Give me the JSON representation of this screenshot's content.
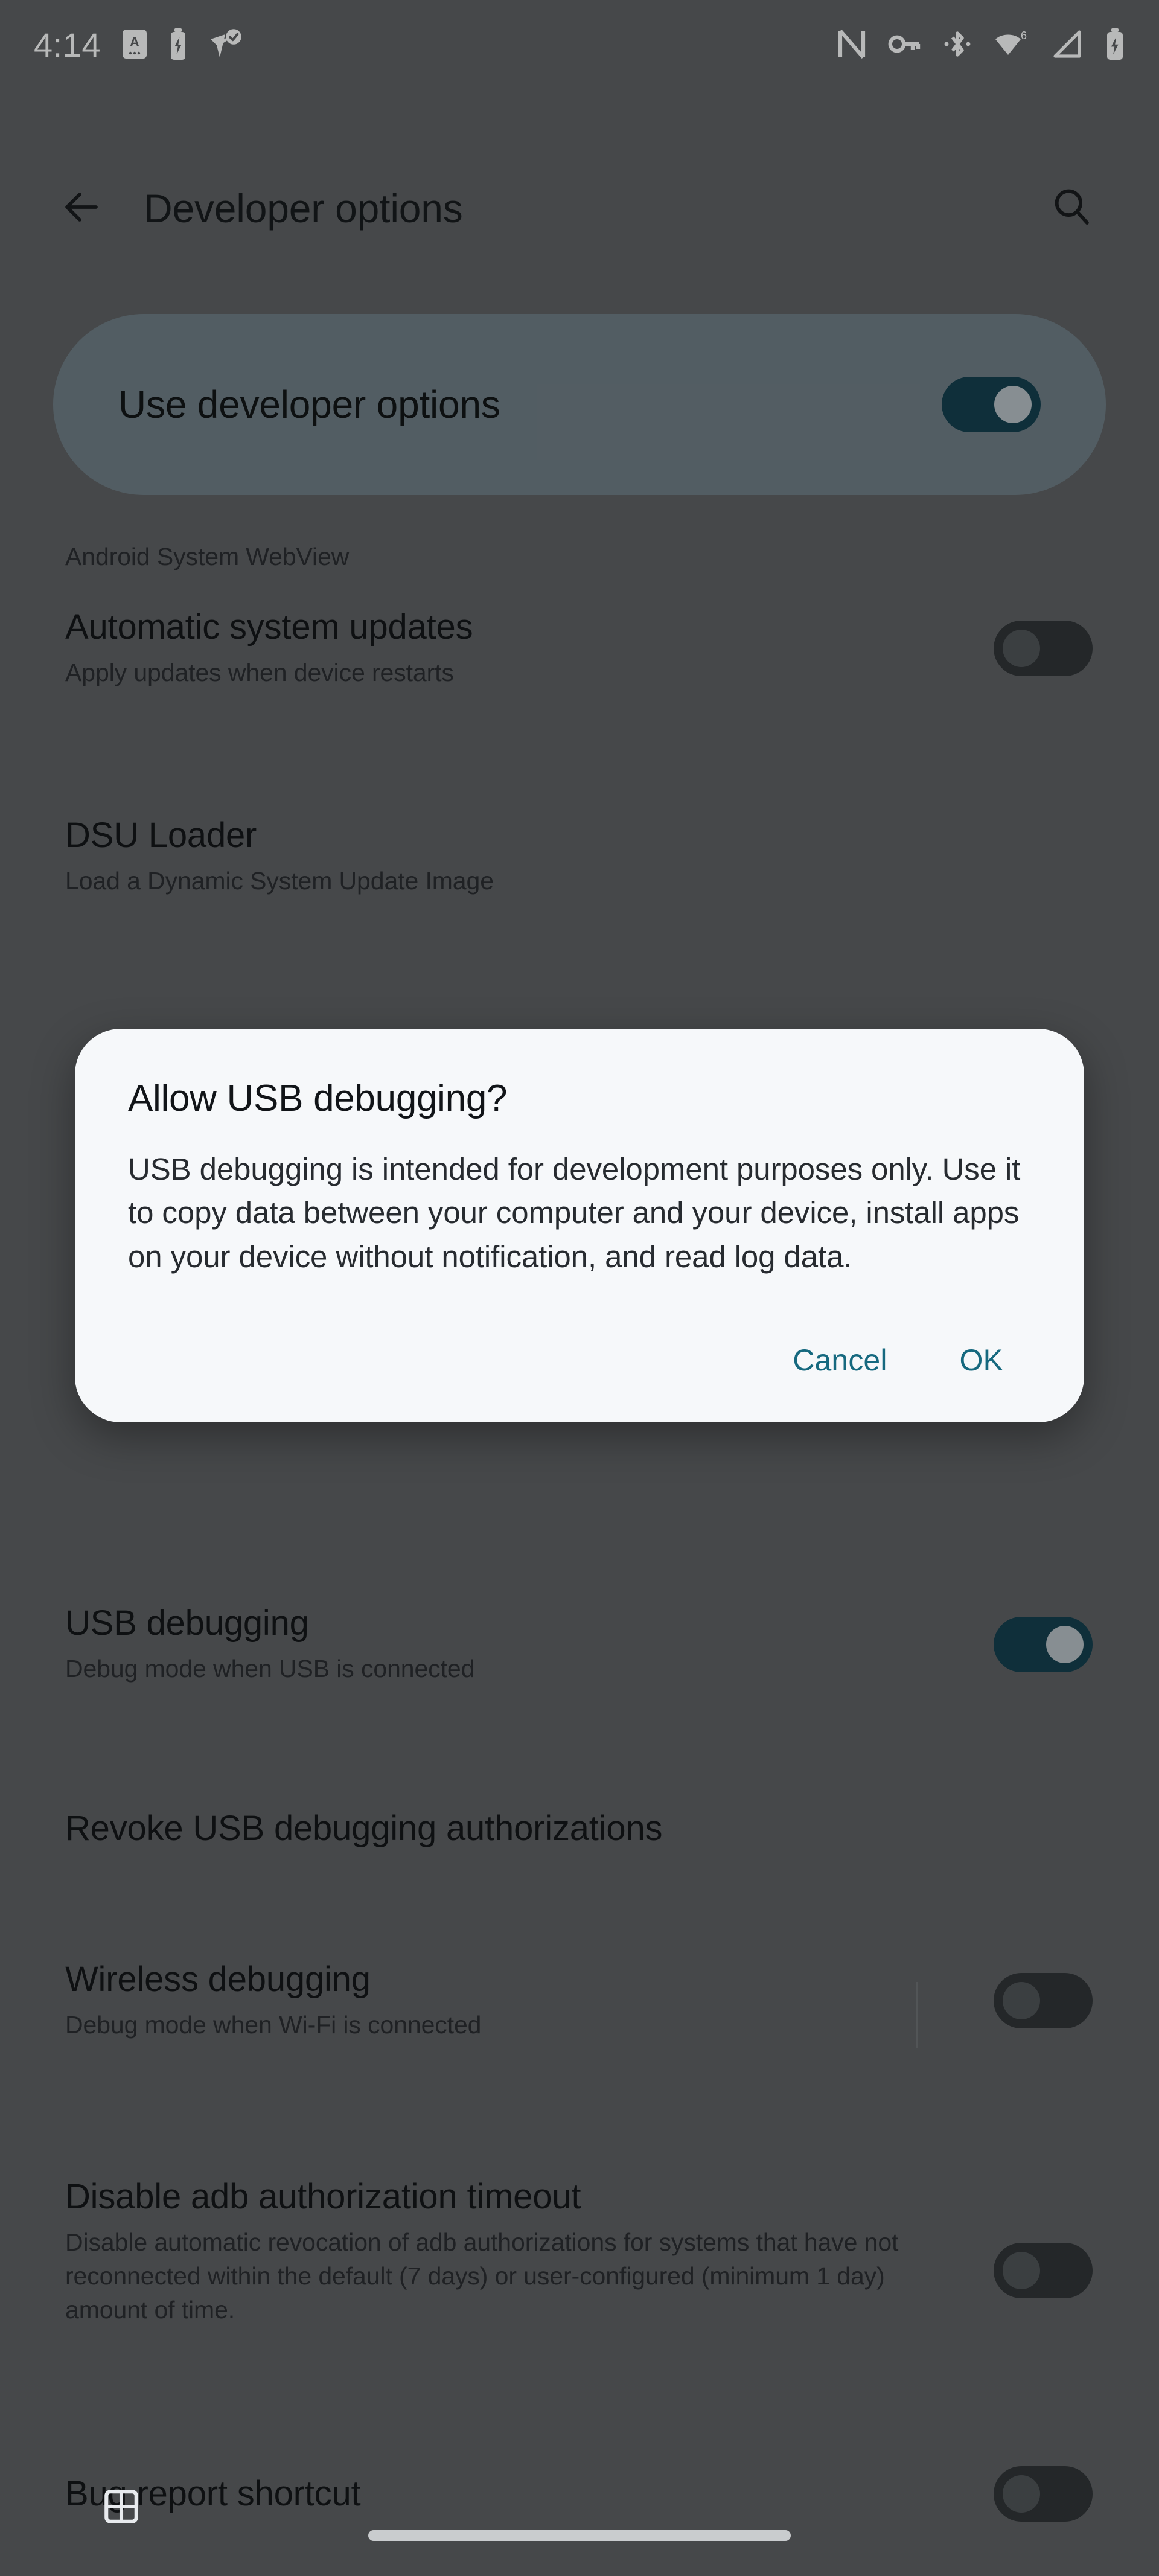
{
  "status_bar": {
    "time": "4:14",
    "left_icons": [
      "app-badge-a-icon",
      "battery-charging-small-icon",
      "location-check-icon"
    ],
    "right_icons": [
      "nfc-icon",
      "vpn-key-icon",
      "bluetooth-icon",
      "wifi-6-icon",
      "cellular-signal-icon",
      "battery-charging-icon"
    ],
    "wifi_badge": "6"
  },
  "app_bar": {
    "back_label": "back-arrow",
    "title": "Developer options",
    "search_label": "search"
  },
  "master_switch": {
    "label": "Use developer options",
    "state": "on"
  },
  "preferences": [
    {
      "id": "android-system-webview",
      "title": "",
      "subtitle": "Android System WebView",
      "has_switch": false
    },
    {
      "id": "automatic-system-updates",
      "title": "Automatic system updates",
      "subtitle": "Apply updates when device restarts",
      "has_switch": true,
      "state": "off"
    },
    {
      "id": "dsu-loader",
      "title": "DSU Loader",
      "subtitle": "Load a Dynamic System Update Image",
      "has_switch": false
    },
    {
      "id": "usb-debugging",
      "title": "USB debugging",
      "subtitle": "Debug mode when USB is connected",
      "has_switch": true,
      "state": "on"
    },
    {
      "id": "revoke-usb-debugging-authorizations",
      "title": "Revoke USB debugging authorizations",
      "subtitle": "",
      "has_switch": false
    },
    {
      "id": "wireless-debugging",
      "title": "Wireless debugging",
      "subtitle": "Debug mode when Wi-Fi is connected",
      "has_switch": true,
      "state": "off",
      "has_divider": true
    },
    {
      "id": "disable-adb-authorization-timeout",
      "title": "Disable adb authorization timeout",
      "subtitle": "Disable automatic revocation of adb authorizations for systems that have not reconnected within the default (7 days) or user-configured (minimum 1 day) amount of time.",
      "has_switch": true,
      "state": "off"
    },
    {
      "id": "bug-report-shortcut",
      "title": "Bug report shortcut",
      "subtitle": "",
      "has_switch": true,
      "state": "off"
    }
  ],
  "dialog": {
    "title": "Allow USB debugging?",
    "body": "USB debugging is intended for development purposes only. Use it to copy data between your computer and your device, install apps on your device without notification, and read log data.",
    "cancel_label": "Cancel",
    "ok_label": "OK"
  },
  "system_nav": {
    "overview_label": "overview",
    "home_indicator_label": "home-indicator"
  },
  "colors": {
    "background": "#5c5e60",
    "card": "#6e7c84",
    "switch_on": "#0d3a4a",
    "switch_off": "#2b2e31",
    "dialog_bg": "#f6f8fa",
    "accent": "#16697f",
    "text_primary": "#0c0e10",
    "text_secondary": "#24262a"
  }
}
